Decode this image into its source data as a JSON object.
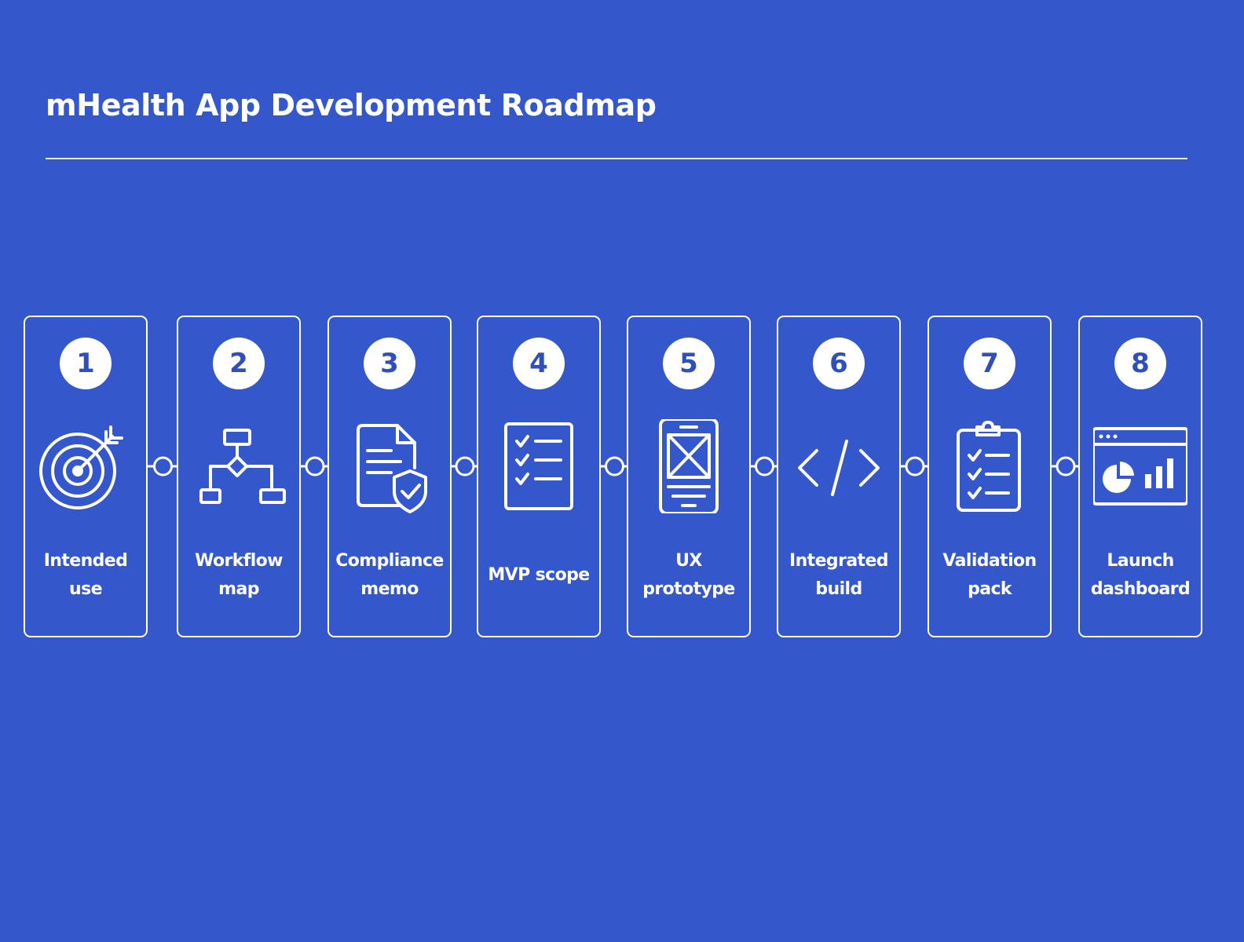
{
  "header": {
    "title": "mHealth App Development Roadmap"
  },
  "steps": [
    {
      "number": "1",
      "label": "Intended use",
      "icon": "target-icon"
    },
    {
      "number": "2",
      "label": "Workflow map",
      "icon": "flowchart-icon"
    },
    {
      "number": "3",
      "label": "Compliance memo",
      "icon": "shield-document-icon"
    },
    {
      "number": "4",
      "label": "MVP scope",
      "icon": "checklist-icon"
    },
    {
      "number": "5",
      "label": "UX prototype",
      "icon": "mobile-wireframe-icon"
    },
    {
      "number": "6",
      "label": "Integrated build",
      "icon": "code-icon"
    },
    {
      "number": "7",
      "label": "Validation pack",
      "icon": "clipboard-checklist-icon"
    },
    {
      "number": "8",
      "label": "Launch dashboard",
      "icon": "dashboard-icon"
    }
  ],
  "colors": {
    "background": "#3457CB",
    "foreground": "#FFFFFF",
    "badge_text": "#2F4FBF"
  }
}
